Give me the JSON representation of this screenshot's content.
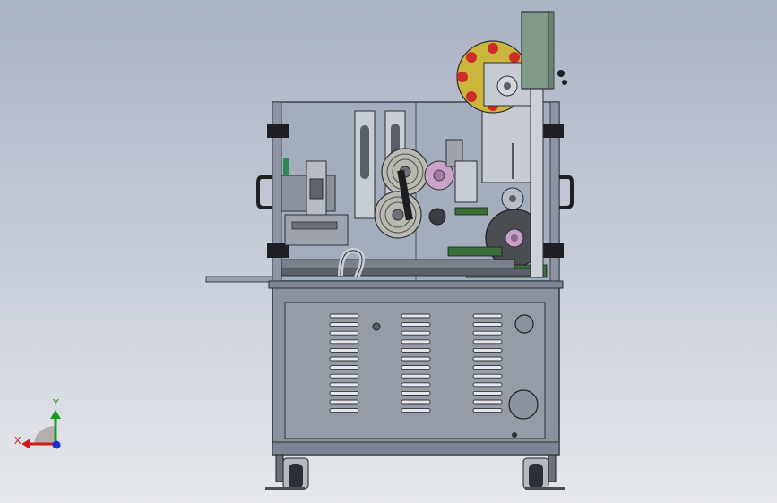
{
  "viewport": {
    "background_top": "#aab3c4",
    "background_bottom": "#e6e8ec"
  },
  "triad": {
    "x_label": "X",
    "y_label": "Y",
    "x_color": "#d01c1c",
    "y_color": "#1a9a1a",
    "z_color": "#1c2fd0"
  },
  "model": {
    "frame_color": "#7d8594",
    "panel_color": "#8c929c",
    "rail_color": "#3a6e3a",
    "reel_color": "#c9b63a",
    "reel_hole_color": "#d12a2a",
    "pink_roller_color": "#c8a0c8",
    "glass_color": "#a3adbc"
  }
}
